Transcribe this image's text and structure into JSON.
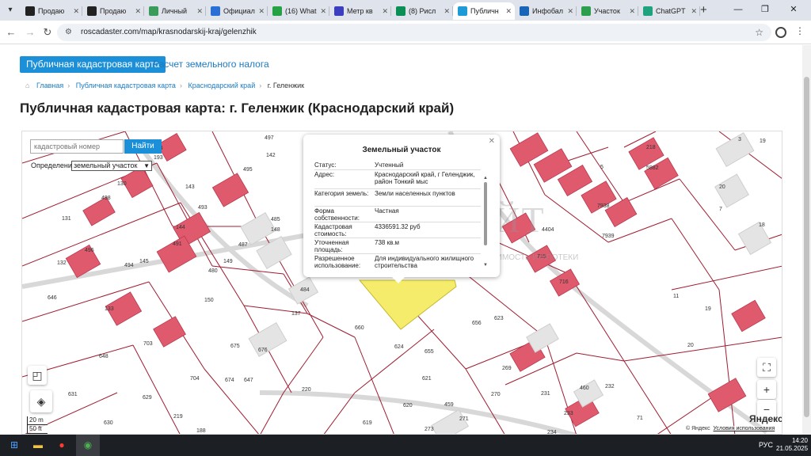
{
  "browser": {
    "tabs": [
      {
        "label": "Продаю",
        "color": "#222"
      },
      {
        "label": "Продаю",
        "color": "#222"
      },
      {
        "label": "Личный",
        "color": "#3b9b5a"
      },
      {
        "label": "Официал",
        "color": "#2a6fd6"
      },
      {
        "label": "(16) What",
        "color": "#25a244"
      },
      {
        "label": "Метр кв",
        "color": "#3b3fbf"
      },
      {
        "label": "(8) Рисл",
        "color": "#0b8f55"
      },
      {
        "label": "Публичн",
        "color": "#1e9bd7"
      },
      {
        "label": "Инфобал",
        "color": "#1665b6"
      },
      {
        "label": "Участок",
        "color": "#2c9f4e"
      },
      {
        "label": "ChatGPT",
        "color": "#1fa37f"
      }
    ],
    "active_tab": 7,
    "url": "roscadaster.com/map/krasnodarskij-kraj/gelenzhik"
  },
  "page": {
    "btn_map": "Публичная кадастровая карта",
    "link_tax": "Расчет земельного налога",
    "breadcrumb": [
      "Главная",
      "Публичная кадастровая карта",
      "Краснодарский край",
      "г. Геленжик"
    ],
    "title": "Публичная кадастровая карта: г. Геленжик (Краснодарский край)"
  },
  "map": {
    "search_placeholder": "кадастровый номер",
    "search_button": "Найти",
    "def_label": "Определение:",
    "def_value": "земельный участок",
    "scale_m": "20 m",
    "scale_ft": "50 ft",
    "attribution": "© Яндекс",
    "terms": "Условия использования",
    "logo": "Яндекс",
    "parcel_numbers": [
      "497",
      "142",
      "498",
      "130",
      "143",
      "131",
      "495",
      "493",
      "485",
      "148",
      "144",
      "496",
      "132",
      "491",
      "145",
      "487",
      "149",
      "480",
      "150",
      "494",
      "133",
      "646",
      "484",
      "137",
      "660",
      "648",
      "703",
      "675",
      "674",
      "624",
      "676",
      "647",
      "704",
      "655",
      "621",
      "220",
      "629",
      "631",
      "630",
      "219",
      "188",
      "619",
      "620",
      "459",
      "271",
      "273",
      "656",
      "623",
      "269",
      "231",
      "270",
      "460",
      "232",
      "234",
      "233",
      "71",
      "716",
      "715",
      "7938",
      "7939",
      "4404",
      "218",
      "5882",
      "194",
      "193",
      "5",
      "3",
      "19",
      "20",
      "7",
      "18",
      "11",
      "19",
      "20"
    ],
    "popup": {
      "title": "Земельный участок",
      "rows": [
        {
          "k": "Статус:",
          "v": "Учтенный"
        },
        {
          "k": "Адрес:",
          "v": "Краснодарский край, г Геленджик, район Тонкий мыс"
        },
        {
          "k": "Категория земель:",
          "v": "Земли населенных пунктов"
        },
        {
          "k": "Форма собственности:",
          "v": "Частная"
        },
        {
          "k": "Кадастровая стоимость:",
          "v": "4336591.32 руб"
        },
        {
          "k": "Уточненная площадь:",
          "v": "738 кв.м"
        },
        {
          "k": "Разрешенное использование:",
          "v": "Для индивидуального жилищного строительства"
        }
      ]
    },
    "watermark": "ЭСТЕЙТ",
    "watermark_sub": "НЕДВИЖИМОСТЬ И ИПОТЕКИ"
  },
  "taskbar": {
    "lang": "РУС",
    "time": "14:20",
    "date": "21.05.2025"
  }
}
